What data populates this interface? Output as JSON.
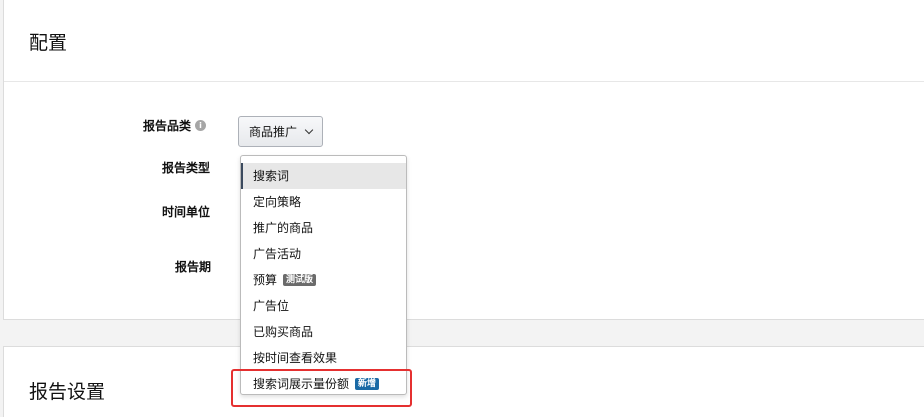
{
  "config": {
    "title": "配置",
    "fields": {
      "report_category": {
        "label": "报告品类",
        "value": "商品推广"
      },
      "report_type": {
        "label": "报告类型"
      },
      "time_unit": {
        "label": "时间单位"
      },
      "report_period": {
        "label": "报告期"
      }
    },
    "info_icon": "info-icon",
    "info_glyph": "i"
  },
  "dropdown": {
    "items": [
      {
        "label": "搜索词",
        "selected": true
      },
      {
        "label": "定向策略"
      },
      {
        "label": "推广的商品"
      },
      {
        "label": "广告活动"
      },
      {
        "label": "预算",
        "badge": "测试版"
      },
      {
        "label": "广告位"
      },
      {
        "label": "已购买商品"
      },
      {
        "label": "按时间查看效果"
      },
      {
        "label": "搜索词展示量份额",
        "badge": "新增"
      }
    ]
  },
  "report_settings": {
    "title": "报告设置"
  },
  "colors": {
    "highlight": "#e53030",
    "badge_beta": "#6b6b6b",
    "badge_new": "#1a6aa6",
    "selected_bg": "#e7e7e7"
  }
}
